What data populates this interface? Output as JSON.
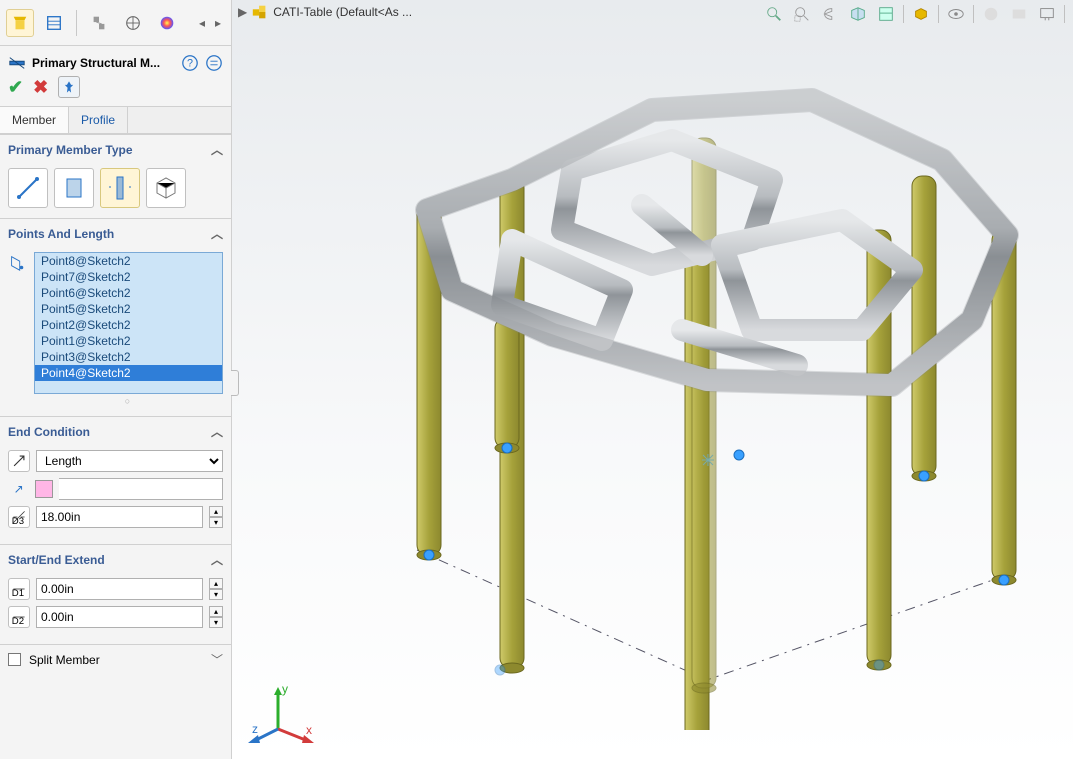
{
  "breadcrumb": {
    "doc_name": "CATI-Table  (Default<As ..."
  },
  "feature": {
    "title": "Primary Structural M...",
    "tabs": {
      "member": "Member",
      "profile": "Profile"
    }
  },
  "primary_member_type": {
    "heading": "Primary Member Type"
  },
  "points_and_length": {
    "heading": "Points And Length",
    "items": [
      "Point8@Sketch2",
      "Point7@Sketch2",
      "Point6@Sketch2",
      "Point5@Sketch2",
      "Point2@Sketch2",
      "Point1@Sketch2",
      "Point3@Sketch2",
      "Point4@Sketch2"
    ],
    "selected_index": 7
  },
  "end_condition": {
    "heading": "End Condition",
    "type": "Length",
    "length": "18.00in"
  },
  "start_end_extend": {
    "heading": "Start/End Extend",
    "d1": "0.00in",
    "d2": "0.00in"
  },
  "split_member": {
    "label": "Split Member",
    "checked": false
  },
  "view_toolbar": {
    "icons": [
      "zoom-fit",
      "zoom-window",
      "lasso",
      "section",
      "display-style",
      "view-orientation",
      "appearance",
      "eye",
      "render",
      "scene",
      "envelope",
      "monitor"
    ]
  },
  "triad": {
    "x": "x",
    "y": "y",
    "z": "z"
  }
}
